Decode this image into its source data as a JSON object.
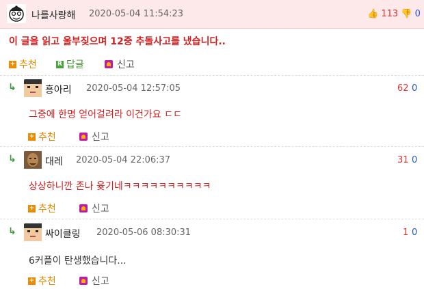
{
  "best": {
    "nick": "나를사랑해",
    "date": "2020-05-04 11:54:23",
    "up": "113",
    "down": "0",
    "body": "이 글을 읽고 울부짖으며 12중 추돌사고를 냈습니다..",
    "actions": {
      "recommend": "추천",
      "reply": "답글",
      "report": "신고"
    },
    "reply_badge": "R"
  },
  "comments": [
    {
      "nick": "흥아리",
      "date": "2020-05-04 12:57:05",
      "up": "62",
      "down": "0",
      "body": "그중에 한명 얻어걸려라 이건가요 ㄷㄷ",
      "recommend": "추천",
      "report": "신고"
    },
    {
      "nick": "대레",
      "date": "2020-05-04 22:06:37",
      "up": "31",
      "down": "0",
      "body": "상상하니깐 존나 윶기네ㅋㅋㅋㅋㅋㅋㅋㅋㅋㅋ",
      "recommend": "추천",
      "report": "신고"
    },
    {
      "nick": "싸이클링",
      "date": "2020-05-06 08:30:31",
      "up": "1",
      "down": "0",
      "body": "6커플이 탄생했습니다...",
      "recommend": "추천",
      "report": "신고"
    }
  ],
  "colors": {
    "best_bg": "#fde9ea",
    "up": "#d33333",
    "down": "#2255cc",
    "highlight_text": "#d31f1f",
    "action": "#e48a00"
  }
}
